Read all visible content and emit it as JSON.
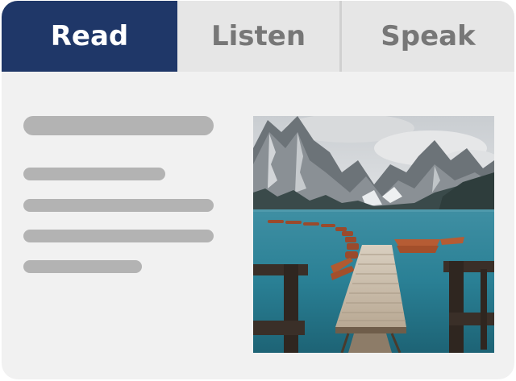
{
  "tabs": [
    {
      "label": "Read",
      "active": true
    },
    {
      "label": "Listen",
      "active": false
    },
    {
      "label": "Speak",
      "active": false
    }
  ],
  "content": {
    "text_placeholder_lines": 5,
    "image": "mountain-lake-dock-photo"
  },
  "colors": {
    "active_tab": "#1f3768",
    "tab_bar": "#e6e6e6",
    "inactive_tab_text": "#777777",
    "panel_background": "#f1f1f1",
    "placeholder_bar": "#b3b3b3",
    "lake": "#2a8095"
  }
}
